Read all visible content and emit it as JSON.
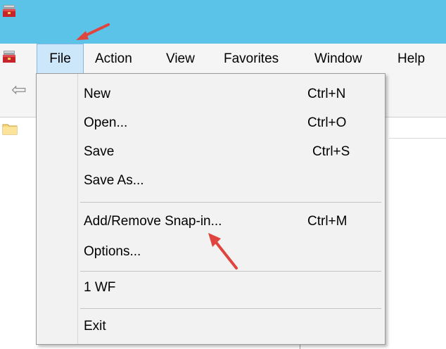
{
  "menubar": {
    "items": [
      {
        "label": "File"
      },
      {
        "label": "Action"
      },
      {
        "label": "View"
      },
      {
        "label": "Favorites"
      },
      {
        "label": "Window"
      },
      {
        "label": "Help"
      }
    ]
  },
  "file_menu": {
    "items": [
      {
        "label": "New",
        "shortcut": "Ctrl+N"
      },
      {
        "label": "Open...",
        "shortcut": "Ctrl+O"
      },
      {
        "label": "Save",
        "shortcut": "Ctrl+S"
      },
      {
        "label": "Save As...",
        "shortcut": ""
      },
      {
        "label": "Add/Remove Snap-in...",
        "shortcut": "Ctrl+M"
      },
      {
        "label": "Options...",
        "shortcut": ""
      },
      {
        "label": "1 WF",
        "shortcut": ""
      },
      {
        "label": "Exit",
        "shortcut": ""
      }
    ]
  },
  "icons": {
    "app": "mmc-toolbox-icon",
    "back": "back-arrow-icon",
    "folder": "folder-icon",
    "annotation": "red-arrow-annotation"
  },
  "colors": {
    "titlebar": "#5bc3e8",
    "menu_highlight": "#cce6fa",
    "menu_highlight_border": "#84b6e6",
    "annotation": "#e0443f"
  }
}
